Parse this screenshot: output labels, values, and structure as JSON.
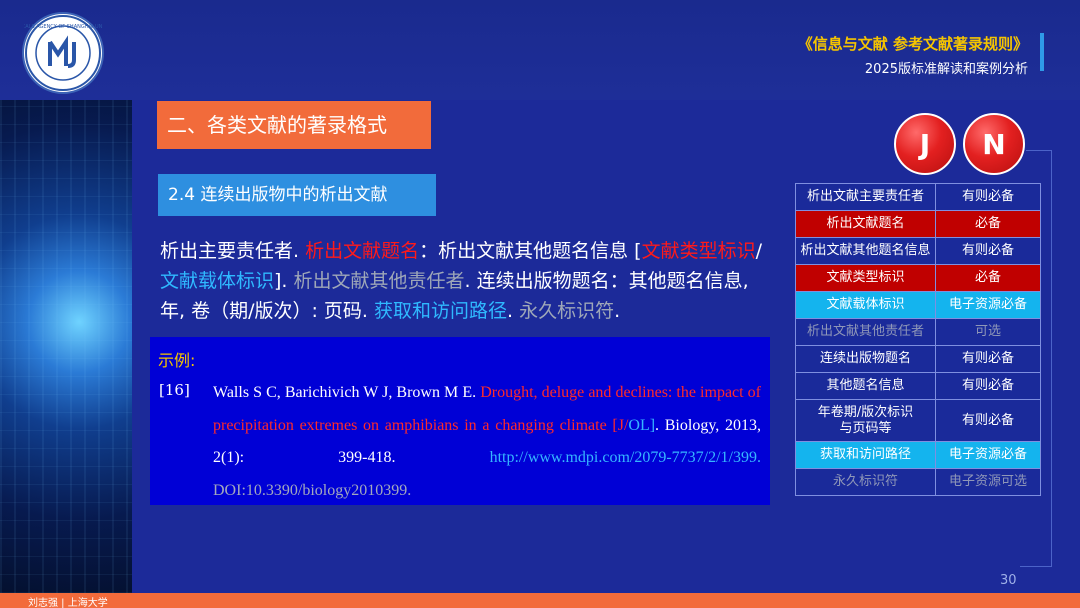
{
  "header": {
    "title_main": "《信息与文献  参考文献著录规则》",
    "title_sub": "2025版标准解读和案例分析"
  },
  "section_title": "二、各类文献的著录格式",
  "subsection_title": "2.4  连续出版物中的析出文献",
  "format_text": [
    {
      "text": "析出主要责任者. ",
      "style": "white"
    },
    {
      "text": "析出文献题名",
      "style": "red"
    },
    {
      "text": "：析出文献其他题名信息  [",
      "style": "white"
    },
    {
      "text": "文献类型标识",
      "style": "red"
    },
    {
      "text": "/",
      "style": "white"
    },
    {
      "text": "文献载体标识",
      "style": "cyan"
    },
    {
      "text": "]. ",
      "style": "white"
    },
    {
      "text": "析出文献其他责任者",
      "style": "gray"
    },
    {
      "text": ". 连续出版物题名：其他题名信息, 年, 卷（期/版次）: 页码. ",
      "style": "white"
    },
    {
      "text": "获取和访问路径",
      "style": "cyan"
    },
    {
      "text": ". ",
      "style": "white"
    },
    {
      "text": "永久标识符",
      "style": "gray"
    },
    {
      "text": ".",
      "style": "white"
    }
  ],
  "example": {
    "label": "示例:",
    "ref_number": "[16]",
    "ref_parts": [
      {
        "text": "Walls S C, Barichivich W J, Brown M E. ",
        "style": "white"
      },
      {
        "text": "Drought, deluge and declines: the impact of precipitation extremes on amphibians in a changing climate ",
        "style": "red"
      },
      {
        "text": "[J/",
        "style": "red"
      },
      {
        "text": "OL]",
        "style": "cyan"
      },
      {
        "text": ". Biology, 2013, 2(1): 399-418. ",
        "style": "white"
      },
      {
        "text": "http://www.mdpi.com/2079-7737/2/1/399. ",
        "style": "cyan"
      },
      {
        "text": "DOI:10.3390/biology2010399.",
        "style": "gray"
      }
    ]
  },
  "badges": {
    "j": "J",
    "n": "N"
  },
  "table": {
    "rows": [
      {
        "field": "析出文献主要责任者",
        "req": "有则必备",
        "bg": "#1a2a9a",
        "color": "#ffffff"
      },
      {
        "field": "析出文献题名",
        "req": "必备",
        "bg": "#c00000",
        "color": "#ffffff"
      },
      {
        "field": "析出文献其他题名信息",
        "req": "有则必备",
        "bg": "#1a2a9a",
        "color": "#ffffff"
      },
      {
        "field": "文献类型标识",
        "req": "必备",
        "bg": "#c00000",
        "color": "#ffffff"
      },
      {
        "field": "文献载体标识",
        "req": "电子资源必备",
        "bg": "#14b4ee",
        "color": "#ffffff"
      },
      {
        "field": "析出文献其他责任者",
        "req": "可选",
        "bg": "#1a2a9a",
        "color": "#8f97b8"
      },
      {
        "field": "连续出版物题名",
        "req": "有则必备",
        "bg": "#1a2a9a",
        "color": "#ffffff"
      },
      {
        "field": "其他题名信息",
        "req": "有则必备",
        "bg": "#1a2a9a",
        "color": "#ffffff"
      },
      {
        "field": "年卷期/版次标识\n与页码等",
        "req": "有则必备",
        "bg": "#1a2a9a",
        "color": "#ffffff"
      },
      {
        "field": "获取和访问路径",
        "req": "电子资源必备",
        "bg": "#14b4ee",
        "color": "#ffffff"
      },
      {
        "field": "永久标识符",
        "req": "电子资源可选",
        "bg": "#1a2a9a",
        "color": "#8f97b8"
      }
    ]
  },
  "page_number": "30",
  "footer_text": "刘志强 | 上海大学",
  "colors": {
    "accent": "#f26b3b",
    "sub_accent": "#2e8fe0",
    "title_gold": "#f5c400"
  }
}
